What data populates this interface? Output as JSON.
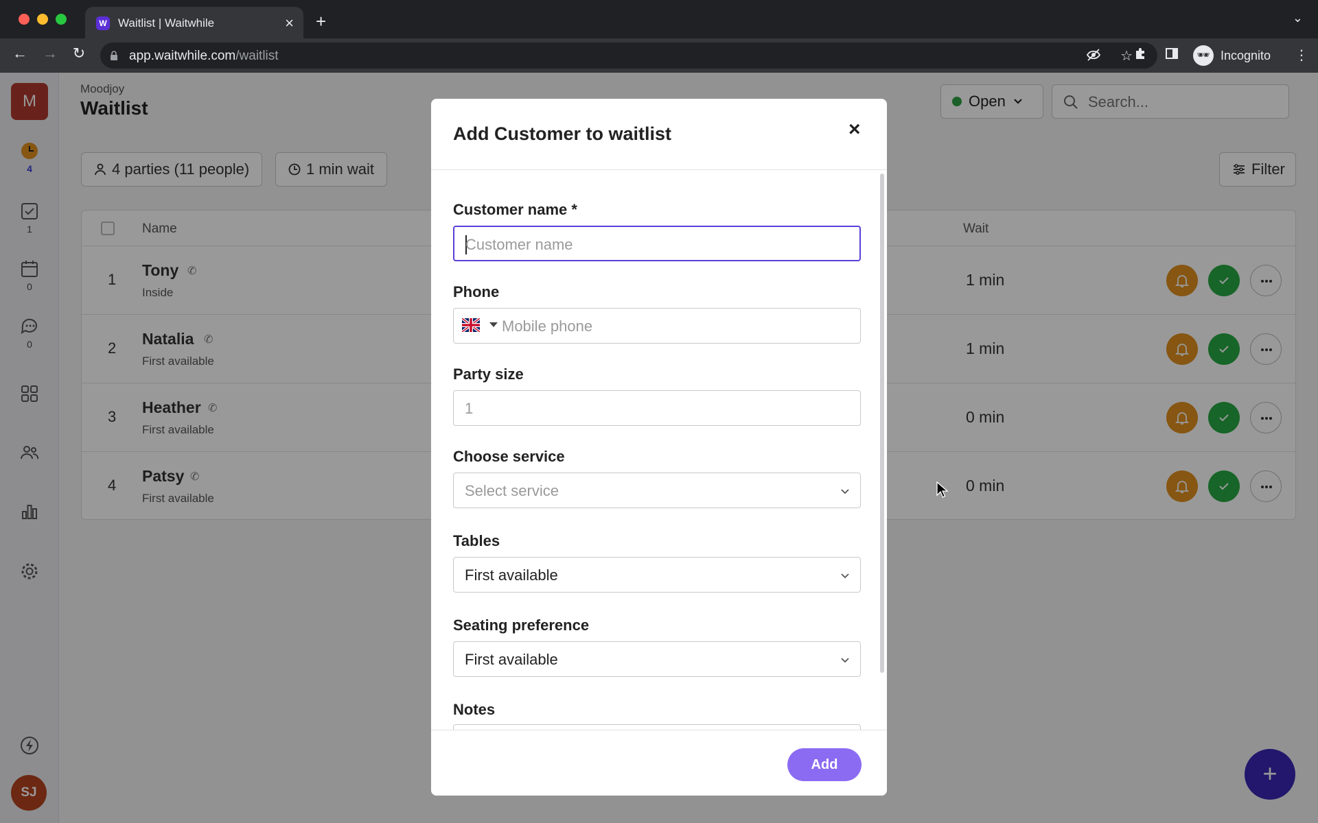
{
  "browser": {
    "tab_title": "Waitlist | Waitwhile",
    "tab_favicon": "W",
    "url_host": "app.waitwhile.com",
    "url_path": "/waitlist",
    "profile_label": "Incognito"
  },
  "sidebar": {
    "brand_initial": "M",
    "items": [
      {
        "icon": "clock-icon",
        "count": "4"
      },
      {
        "icon": "checkbox-icon",
        "count": "1"
      },
      {
        "icon": "calendar-icon",
        "count": "0"
      },
      {
        "icon": "chat-icon",
        "count": "0"
      },
      {
        "icon": "grid-icon"
      },
      {
        "icon": "users-icon"
      },
      {
        "icon": "bar-chart-icon"
      },
      {
        "icon": "gear-icon"
      },
      {
        "icon": "lightning-icon"
      }
    ],
    "user_initials": "SJ"
  },
  "header": {
    "org_name": "Moodjoy",
    "title": "Waitlist",
    "status_label": "Open",
    "search_placeholder": "Search..."
  },
  "stats": {
    "parties": "4 parties (11 people)",
    "wait": "1 min wait",
    "filter_label": "Filter"
  },
  "table": {
    "columns": {
      "name": "Name",
      "wait": "Wait"
    },
    "rows": [
      {
        "num": "1",
        "name": "Tony",
        "sub": "Inside",
        "wait": "1 min"
      },
      {
        "num": "2",
        "name": "Natalia",
        "sub": "First available",
        "wait": "1 min"
      },
      {
        "num": "3",
        "name": "Heather",
        "sub": "First available",
        "wait": "0 min"
      },
      {
        "num": "4",
        "name": "Patsy",
        "sub": "First available",
        "wait": "0 min"
      }
    ]
  },
  "modal": {
    "title": "Add Customer to waitlist",
    "close": "×",
    "fields": {
      "customer_name": {
        "label": "Customer name *",
        "placeholder": "Customer name"
      },
      "phone": {
        "label": "Phone",
        "placeholder": "Mobile phone",
        "country": "GB"
      },
      "party_size": {
        "label": "Party size",
        "placeholder": "1"
      },
      "service": {
        "label": "Choose service",
        "placeholder": "Select service"
      },
      "tables": {
        "label": "Tables",
        "value": "First available"
      },
      "seating": {
        "label": "Seating preference",
        "value": "First available"
      },
      "notes": {
        "label": "Notes"
      }
    },
    "add_label": "Add"
  },
  "colors": {
    "accent": "#5a3fd8",
    "add_button": "#8b6bf2",
    "notify": "#e08f1f",
    "seat": "#27a844",
    "fab": "#3a27b4",
    "open_dot": "#2ea043"
  }
}
